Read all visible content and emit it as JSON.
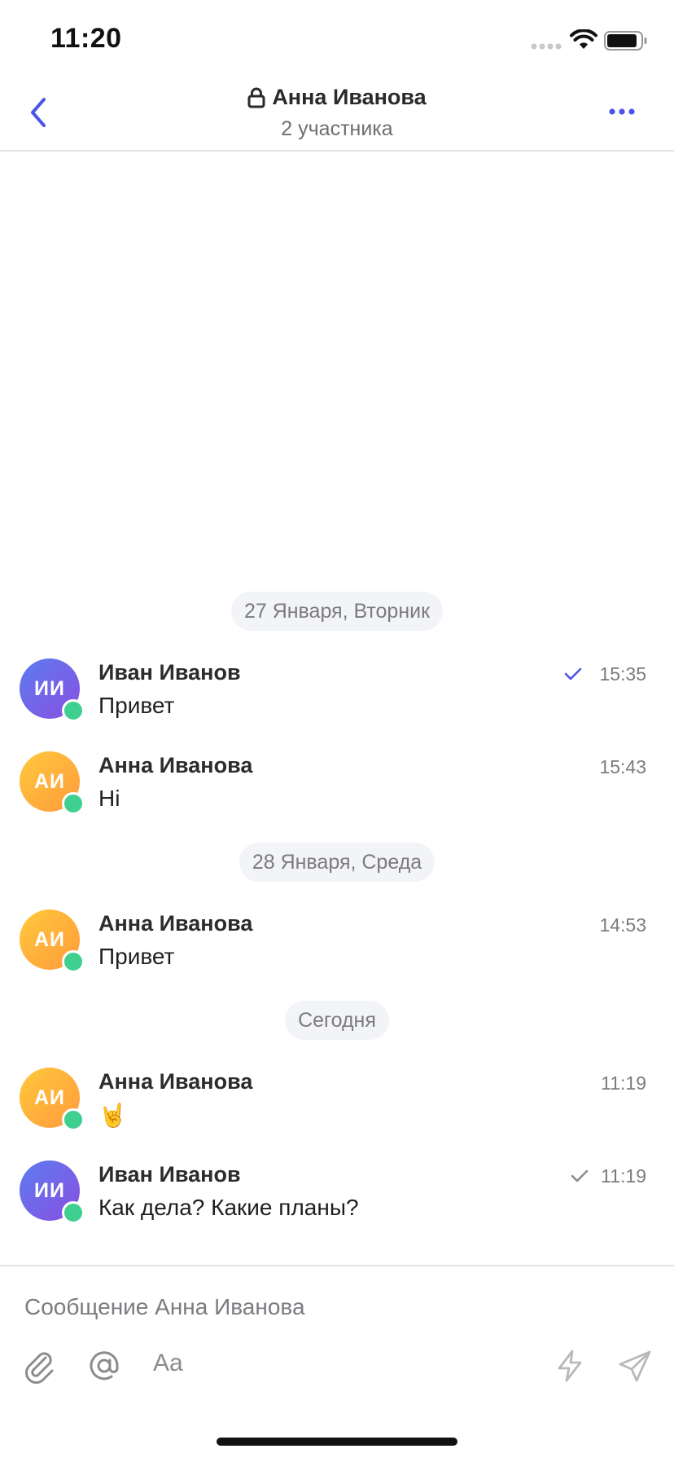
{
  "status_bar": {
    "time": "11:20"
  },
  "header": {
    "title": "Анна Иванова",
    "subtitle": "2 участника"
  },
  "colors": {
    "accent": "#4a55e8",
    "online": "#3fcf8e",
    "date_pill_bg": "#f3f4f7"
  },
  "icons": {
    "back": "chevron-left-icon",
    "lock": "lock-icon",
    "more": "more-horizontal-icon",
    "attach": "paperclip-icon",
    "mention": "at-icon",
    "format": "text-format-icon",
    "quick": "lightning-icon",
    "send": "send-icon"
  },
  "dates": {
    "jan27": "27 Января, Вторник",
    "jan28": "28 Января, Среда",
    "today": "Сегодня"
  },
  "messages": [
    {
      "avatar_initials": "ИИ",
      "author": "Иван Иванов",
      "text": "Привет",
      "time": "15:35",
      "check_status": "read"
    },
    {
      "avatar_initials": "АИ",
      "author": "Анна Иванова",
      "text": "Hi",
      "time": "15:43"
    },
    {
      "avatar_initials": "АИ",
      "author": "Анна Иванова",
      "text": "Привет",
      "time": "14:53"
    },
    {
      "avatar_initials": "АИ",
      "author": "Анна Иванова",
      "text": "🤘",
      "time": "11:19"
    },
    {
      "avatar_initials": "ИИ",
      "author": "Иван Иванов",
      "text": "Как дела? Какие планы?",
      "time": "11:19",
      "check_status": "sent"
    }
  ],
  "composer": {
    "placeholder": "Сообщение Анна Иванова",
    "format_label": "Aa"
  }
}
